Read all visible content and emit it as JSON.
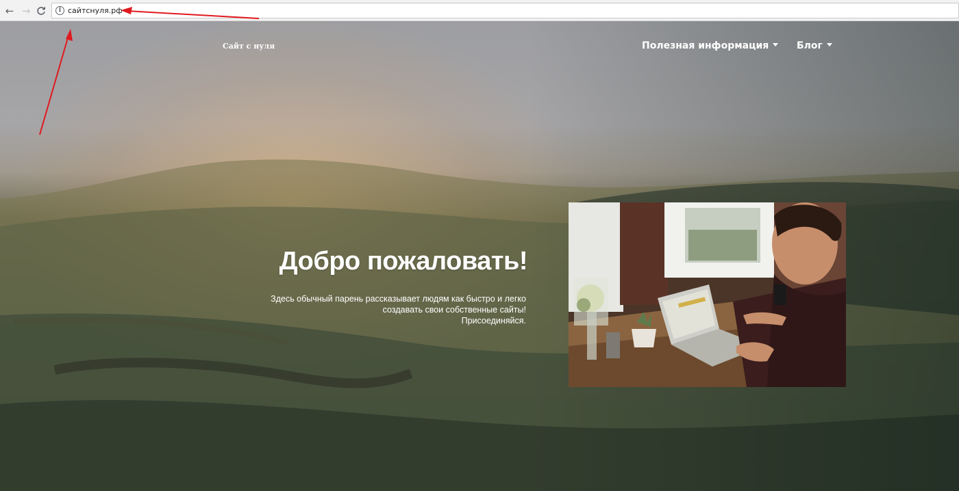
{
  "browser": {
    "url": "сайтснуля.рф",
    "back_icon": "arrow-left-icon",
    "forward_icon": "arrow-right-icon",
    "reload_icon": "reload-icon",
    "site_info_icon": "info-icon"
  },
  "site": {
    "brand": "Сайт с нуля",
    "nav": [
      {
        "label": "Полезная информация",
        "icon": "caret-down-icon"
      },
      {
        "label": "Блог",
        "icon": "caret-down-icon"
      }
    ]
  },
  "hero": {
    "title": "Добро пожаловать!",
    "lines": [
      "Здесь обычный парень рассказывает людям как быстро и легко",
      "создавать свои собственные сайты!",
      "Присоединяйся."
    ],
    "photo_subject": "man working on laptop at wooden desk"
  },
  "colors": {
    "annotation_arrow": "#e0191e",
    "text": "#ffffff"
  }
}
